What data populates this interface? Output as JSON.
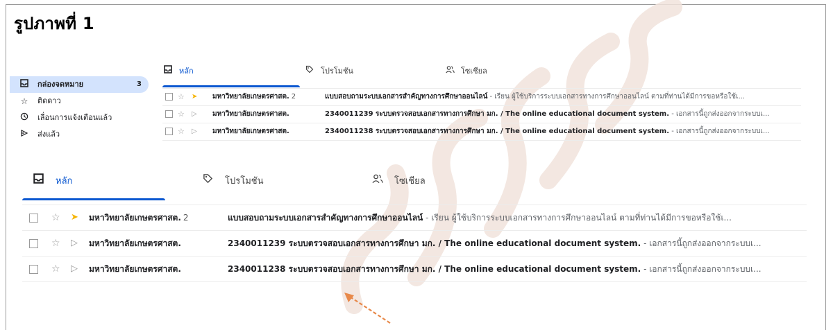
{
  "figure": {
    "title": "รูปภาพที่ 1"
  },
  "sidebar": {
    "items": [
      {
        "label": "กล่องจดหมาย",
        "icon": "inbox-icon",
        "count": "3",
        "active": true
      },
      {
        "label": "ติดดาว",
        "icon": "star-icon"
      },
      {
        "label": "เลื่อนการแจ้งเตือนแล้ว",
        "icon": "clock-icon"
      },
      {
        "label": "ส่งแล้ว",
        "icon": "send-icon"
      }
    ]
  },
  "tabs": [
    {
      "label": "หลัก",
      "icon": "inbox-icon",
      "active": true
    },
    {
      "label": "โปรโมชัน",
      "icon": "tag-icon"
    },
    {
      "label": "โซเชียล",
      "icon": "people-icon"
    }
  ],
  "emails": [
    {
      "sender": "มหาวิทยาลัยเกษตรศาสตร์",
      "sender_display": "มหาวิทยาลัยเกษตรศาสต.",
      "count": "2",
      "important": true,
      "subject": "แบบสอบถามระบบเอกสารสำคัญทางการศึกษาออนไลน์",
      "snippet": " - เรียน ผู้ใช้บริการระบบเอกสารทางการศึกษาออนไลน์ ตามที่ท่านได้มีการขอหรือใช้เ..."
    },
    {
      "sender_display": "มหาวิทยาลัยเกษตรศาสต.",
      "count": "",
      "important": false,
      "subject": "2340011239 ระบบตรวจสอบเอกสารทางการศึกษา มก. / The online educational document system.",
      "snippet": " - เอกสารนี้ถูกส่งออกจากระบบเ..."
    },
    {
      "sender_display": "มหาวิทยาลัยเกษตรศาสต.",
      "count": "",
      "important": false,
      "subject": "2340011238 ระบบตรวจสอบเอกสารทางการศึกษา มก. / The online educational document system.",
      "snippet": " - เอกสารนี้ถูกส่งออกจากระบบเ..."
    }
  ],
  "colors": {
    "accent": "#0b57d0",
    "active_nav_bg": "#d3e3fd",
    "important_marker": "#f5b400",
    "annotation_arrow": "#e8894a"
  }
}
